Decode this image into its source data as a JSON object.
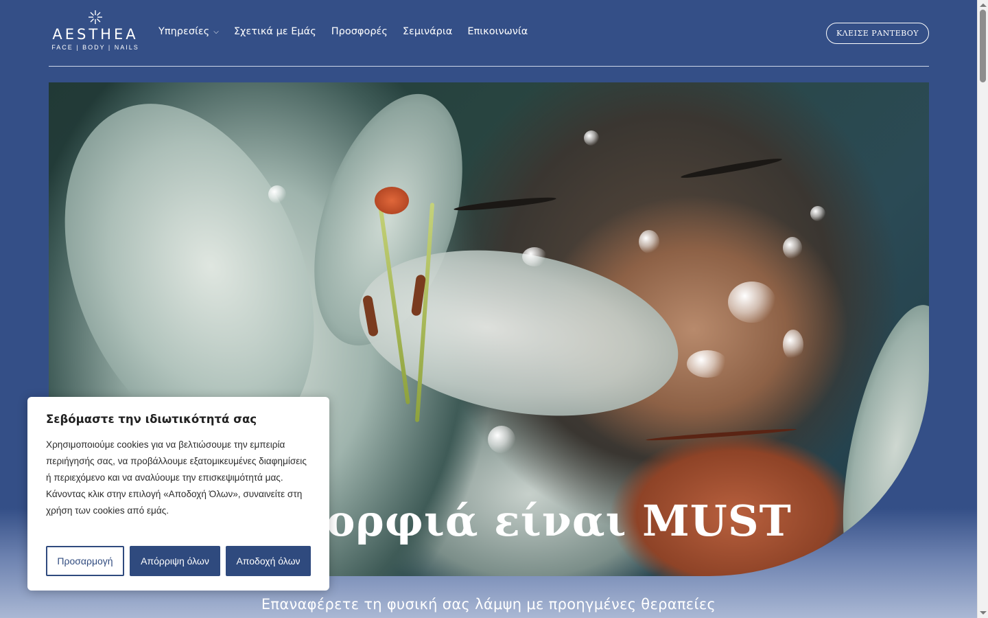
{
  "brand": {
    "name": "AESTHEA",
    "tagline": "FACE | BODY | NAILS",
    "logo_icon": "flower-mark-icon"
  },
  "nav": {
    "items": [
      {
        "label": "Υπηρεσίες",
        "has_dropdown": true
      },
      {
        "label": "Σχετικά με Εμάς"
      },
      {
        "label": "Προσφορές"
      },
      {
        "label": "Σεμινάρια"
      },
      {
        "label": "Επικοινωνία"
      }
    ],
    "cta_label": "ΚΛΕΙΣΕ ΡΑΝΤΕΒΟΥ"
  },
  "hero": {
    "title": "κή ομορφιά είναι MUST",
    "subtitle": "Επαναφέρετε τη φυσική σας λάμψη με προηγμένες θεραπείες"
  },
  "cookie": {
    "title": "Σεβόμαστε την ιδιωτικότητά σας",
    "text": "Χρησιμοποιούμε cookies για να βελτιώσουμε την εμπειρία περιήγησής σας, να προβάλλουμε εξατομικευμένες διαφημίσεις ή περιεχόμενο και να αναλύουμε την επισκεψιμότητά μας. Κάνοντας κλικ στην επιλογή «Αποδοχή Όλων», συναινείτε στη χρήση των cookies από εμάς.",
    "customize_label": "Προσαρμογή",
    "reject_label": "Απόρριψη όλων",
    "accept_label": "Αποδοχή όλων"
  },
  "colors": {
    "background": "#344f87",
    "button": "#2f4a7e",
    "text_light": "#ffffff"
  }
}
